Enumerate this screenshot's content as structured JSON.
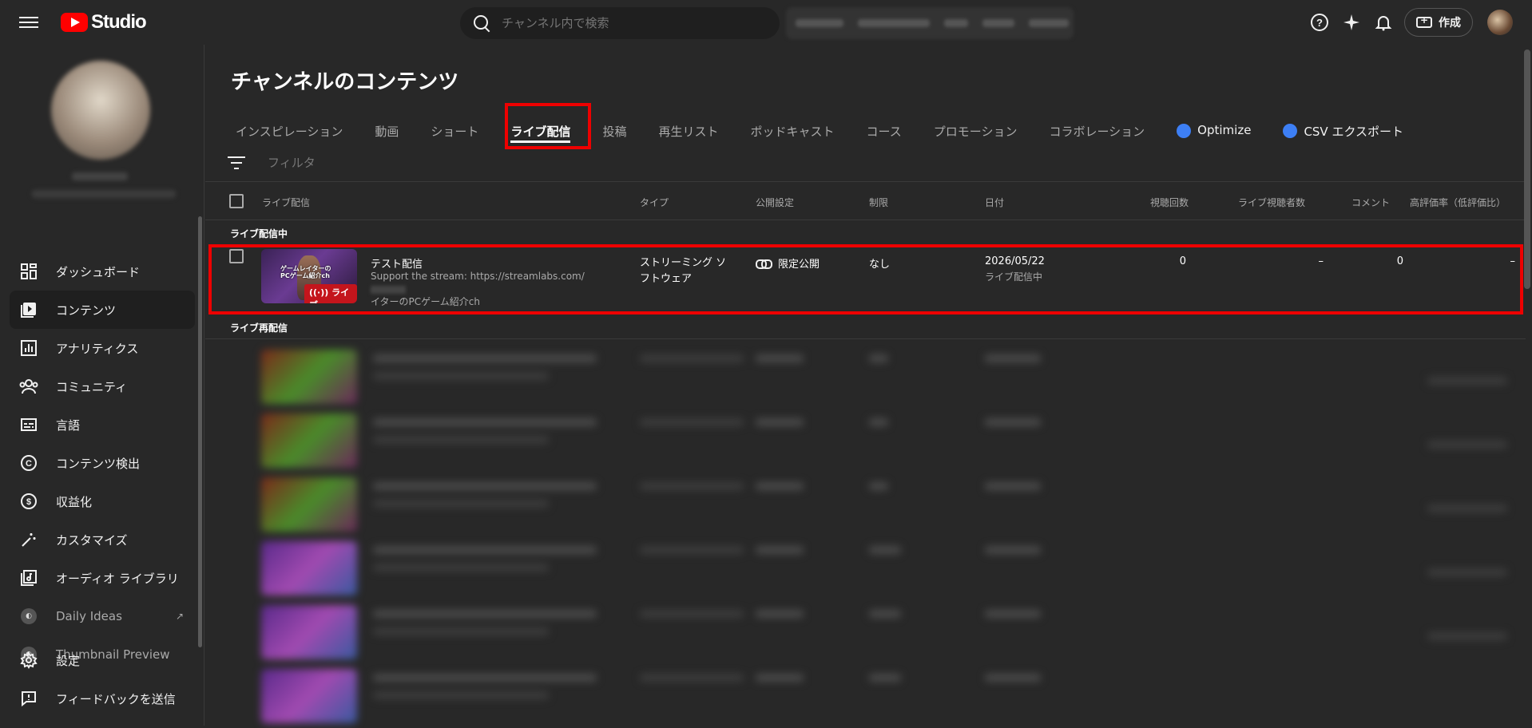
{
  "app": {
    "logo_text": "Studio"
  },
  "search": {
    "placeholder": "チャンネル内で検索"
  },
  "topbar": {
    "create_label": "作成"
  },
  "sidebar": {
    "items": [
      {
        "label": "ダッシュボード",
        "icon": "dashboard-icon"
      },
      {
        "label": "コンテンツ",
        "icon": "content-icon",
        "active": true
      },
      {
        "label": "アナリティクス",
        "icon": "analytics-icon"
      },
      {
        "label": "コミュニティ",
        "icon": "community-icon"
      },
      {
        "label": "言語",
        "icon": "subtitles-icon"
      },
      {
        "label": "コンテンツ検出",
        "icon": "copyright-icon"
      },
      {
        "label": "収益化",
        "icon": "monetization-icon"
      },
      {
        "label": "カスタマイズ",
        "icon": "customization-icon"
      },
      {
        "label": "オーディオ ライブラリ",
        "icon": "audio-library-icon"
      },
      {
        "label": "Daily Ideas",
        "icon": "extension-icon"
      },
      {
        "label": "Thumbnail Preview",
        "icon": "extension-icon"
      }
    ],
    "bottom": [
      {
        "label": "設定",
        "icon": "settings-icon"
      },
      {
        "label": "フィードバックを送信",
        "icon": "feedback-icon"
      }
    ]
  },
  "main": {
    "title": "チャンネルのコンテンツ",
    "tabs": [
      {
        "label": "インスピレーション"
      },
      {
        "label": "動画"
      },
      {
        "label": "ショート"
      },
      {
        "label": "ライブ配信",
        "active": true
      },
      {
        "label": "投稿"
      },
      {
        "label": "再生リスト"
      },
      {
        "label": "ポッドキャスト"
      },
      {
        "label": "コース"
      },
      {
        "label": "プロモーション"
      },
      {
        "label": "コラボレーション"
      },
      {
        "label": "Optimize",
        "extension": true
      },
      {
        "label": "CSV エクスポート",
        "extension": true
      }
    ],
    "filter_placeholder": "フィルタ",
    "columns": {
      "live": "ライブ配信",
      "type": "タイプ",
      "visibility": "公開設定",
      "restrictions": "制限",
      "date": "日付",
      "views": "視聴回数",
      "live_viewers": "ライブ視聴者数",
      "comments": "コメント",
      "like_ratio": "高評価率（低評価比）"
    },
    "section_live_now": "ライブ配信中",
    "section_replays": "ライブ再配信",
    "live_row": {
      "thumb_text_1": "ゲームレイターの",
      "thumb_text_2": "PCゲーム紹介ch",
      "badge": "ライブ",
      "title": "テスト配信",
      "desc_1": "Support the stream: https://streamlabs.com/",
      "desc_2": "イターのPCゲーム紹介ch",
      "type": "ストリーミング ソフトウェア",
      "visibility": "限定公開",
      "restrictions": "なし",
      "date": "2026/05/22",
      "date_status": "ライブ配信中",
      "views": "0",
      "live_viewers": "–",
      "comments": "0",
      "like_ratio": "–"
    }
  }
}
